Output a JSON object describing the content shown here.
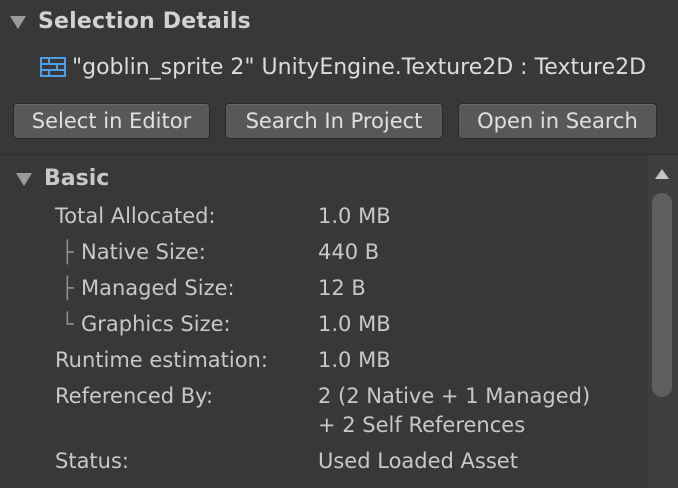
{
  "header": {
    "title": "Selection Details",
    "object_name": "\"goblin_sprite 2\" UnityEngine.Texture2D : Texture2D",
    "object_icon": "texture-icon"
  },
  "buttons": {
    "select_in_editor": "Select in Editor",
    "search_in_project": "Search In Project",
    "open_in_search": "Open in Search"
  },
  "basic": {
    "title": "Basic",
    "rows": [
      {
        "label": "Total Allocated:",
        "value": "1.0 MB"
      },
      {
        "glyph": "├",
        "label": "Native Size:",
        "value": "440 B"
      },
      {
        "glyph": "├",
        "label": "Managed Size:",
        "value": "12 B"
      },
      {
        "glyph": "└",
        "label": "Graphics Size:",
        "value": "1.0 MB"
      },
      {
        "label": "Runtime estimation:",
        "value": "1.0 MB"
      },
      {
        "label": "Referenced By:",
        "value": "2 (2 Native + 1 Managed)",
        "value_line2": "+ 2 Self References"
      },
      {
        "label": "Status:",
        "value": "Used Loaded Asset"
      }
    ]
  },
  "colors": {
    "background": "#383838",
    "button": "#585858",
    "text": "#d2d2d2",
    "texture_icon": "#4f9fe8"
  }
}
